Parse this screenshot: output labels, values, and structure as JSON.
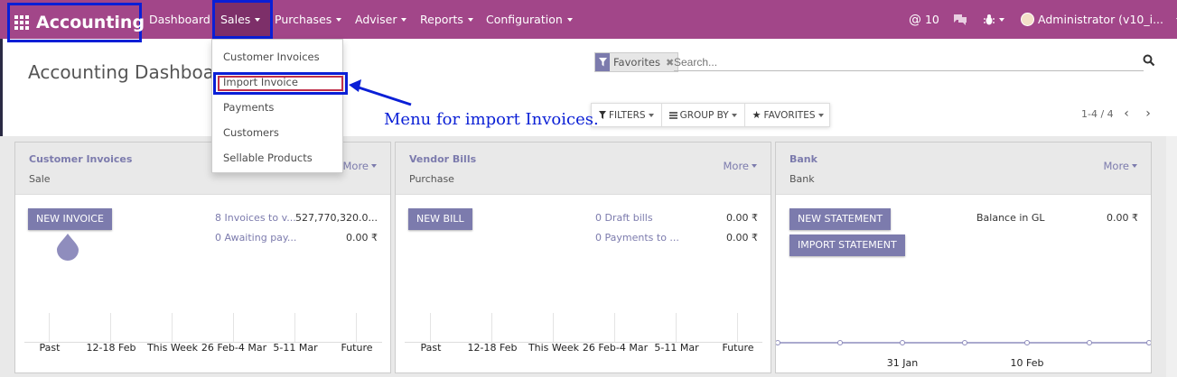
{
  "app": {
    "brand": "Accounting",
    "nav": [
      {
        "label": "Dashboard",
        "caret": false
      },
      {
        "label": "Sales",
        "caret": true
      },
      {
        "label": "Purchases",
        "caret": true
      },
      {
        "label": "Adviser",
        "caret": true
      },
      {
        "label": "Reports",
        "caret": true
      },
      {
        "label": "Configuration",
        "caret": true
      }
    ],
    "mentions_count": "10",
    "user": "Administrator (v10_i..."
  },
  "sales_menu": {
    "items": [
      "Customer Invoices",
      "Import Invoice",
      "Payments",
      "Customers",
      "Sellable Products"
    ]
  },
  "page": {
    "title": "Accounting Dashboard",
    "annotation": "Menu for import Invoices."
  },
  "search": {
    "facet_label": "Favorites",
    "placeholder": "Search..."
  },
  "toolbar": {
    "filters": "FILTERS",
    "group_by": "GROUP BY",
    "favorites": "FAVORITES",
    "pager": "1-4 / 4"
  },
  "cards": [
    {
      "title": "Customer Invoices",
      "subtitle": "Sale",
      "more": "More",
      "button": "NEW INVOICE",
      "stats": [
        {
          "label": "8 Invoices to v...",
          "value": "527,770,320.0..."
        },
        {
          "label": "0 Awaiting pay...",
          "value": "0.00 ₹"
        }
      ],
      "x_labels": [
        "Past",
        "12-18 Feb",
        "This Week",
        "26 Feb-4 Mar",
        "5-11 Mar",
        "Future"
      ]
    },
    {
      "title": "Vendor Bills",
      "subtitle": "Purchase",
      "more": "More",
      "button": "NEW BILL",
      "stats": [
        {
          "label": "0 Draft bills",
          "value": "0.00 ₹"
        },
        {
          "label": "0 Payments to ...",
          "value": "0.00 ₹"
        }
      ],
      "x_labels": [
        "Past",
        "12-18 Feb",
        "This Week",
        "26 Feb-4 Mar",
        "5-11 Mar",
        "Future"
      ]
    },
    {
      "title": "Bank",
      "subtitle": "Bank",
      "more": "More",
      "buttons": [
        "NEW STATEMENT",
        "IMPORT STATEMENT"
      ],
      "balance_label": "Balance in GL",
      "balance_value": "0.00 ₹",
      "x_labels": [
        "31 Jan",
        "10 Feb"
      ]
    }
  ],
  "colors": {
    "navbar": "#a24689",
    "accent": "#7c7bad",
    "highlight_box": "#0a1fd6"
  }
}
